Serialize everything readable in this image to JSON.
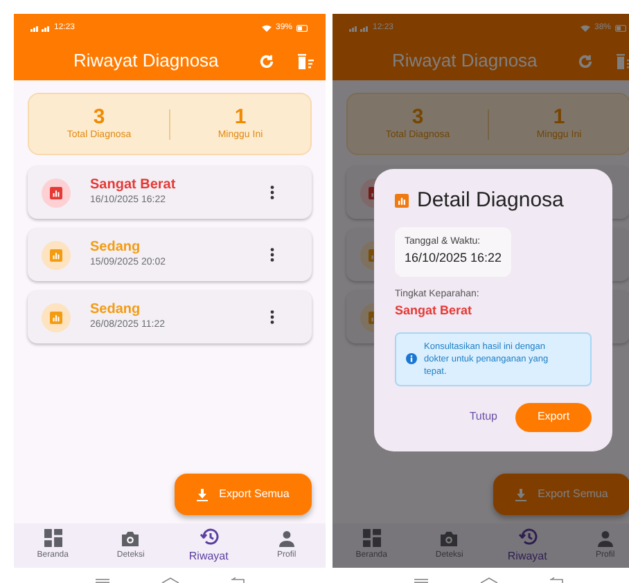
{
  "screens": [
    {
      "status_bar": {
        "time": "12:23",
        "battery": "39%"
      },
      "header": {
        "title": "Riwayat Diagnosa"
      },
      "stats": [
        {
          "value": "3",
          "label": "Total Diagnosa"
        },
        {
          "value": "1",
          "label": "Minggu Ini"
        }
      ],
      "history": [
        {
          "kind": "severe",
          "severity": "Sangat Berat",
          "datetime": "16/10/2025 16:22"
        },
        {
          "kind": "moderate",
          "severity": "Sedang",
          "datetime": "15/09/2025 20:02"
        },
        {
          "kind": "moderate",
          "severity": "Sedang",
          "datetime": "26/08/2025 11:22"
        }
      ],
      "fab": {
        "label": "Export Semua"
      },
      "nav": [
        {
          "kind": "home",
          "label": "Beranda",
          "selected": false
        },
        {
          "kind": "camera",
          "label": "Deteksi",
          "selected": false
        },
        {
          "kind": "history",
          "label": "Riwayat",
          "selected": true
        },
        {
          "kind": "profile",
          "label": "Profil",
          "selected": false
        }
      ]
    },
    {
      "status_bar": {
        "time": "12:23",
        "battery": "38%"
      },
      "header": {
        "title": "Riwayat Diagnosa"
      },
      "stats": [
        {
          "value": "3",
          "label": "Total Diagnosa"
        },
        {
          "value": "1",
          "label": "Minggu Ini"
        }
      ],
      "history": [
        {
          "kind": "severe"
        },
        {
          "kind": "moderate"
        },
        {
          "kind": "moderate"
        }
      ],
      "fab": {
        "label": "Export Semua"
      },
      "nav": [
        {
          "kind": "home",
          "label": "Beranda",
          "selected": false
        },
        {
          "kind": "camera",
          "label": "Deteksi",
          "selected": false
        },
        {
          "kind": "history",
          "label": "Riwayat",
          "selected": true
        },
        {
          "kind": "profile",
          "label": "Profil",
          "selected": false
        }
      ],
      "dialog": {
        "title": "Detail Diagnosa",
        "datetime_label": "Tanggal & Waktu:",
        "datetime": "16/10/2025 16:22",
        "severity_label": "Tingkat Keparahan:",
        "severity": {
          "kind": "severe",
          "text": "Sangat Berat"
        },
        "note": "Konsultasikan hasil ini dengan dokter untuk penanganan yang tepat.",
        "buttons": [
          {
            "kind": "text",
            "label": "Tutup"
          },
          {
            "kind": "filled",
            "label": "Export"
          }
        ]
      }
    }
  ]
}
